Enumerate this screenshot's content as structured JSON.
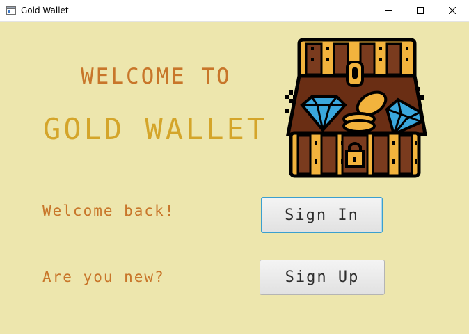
{
  "window": {
    "title": "Gold Wallet",
    "controls": [
      "minimize-icon",
      "maximize-icon",
      "close-icon"
    ]
  },
  "main": {
    "welcome_line": "WELCOME TO",
    "app_name": "GOLD WALLET",
    "returning_prompt": "Welcome back!",
    "new_prompt": "Are you new?",
    "sign_in_label": "Sign In",
    "sign_up_label": "Sign Up",
    "logo_icon": "treasure-chest-icon"
  },
  "colors": {
    "background": "#ede6ad",
    "heading_orange": "#c8762a",
    "heading_gold": "#d4a52a",
    "focus_border": "#3b9fcf"
  }
}
